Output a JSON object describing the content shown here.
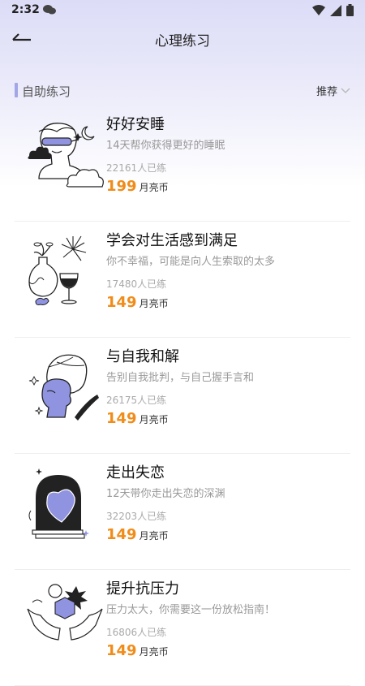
{
  "status": {
    "time": "2:32"
  },
  "header": {
    "title": "心理练习"
  },
  "section": {
    "title": "自助练习",
    "sort_label": "推荐"
  },
  "colors": {
    "accent": "#a3a6e6",
    "price": "#f08c1a",
    "illustration": "#8f93e0"
  },
  "items": [
    {
      "title": "好好安睡",
      "desc": "14天帮你获得更好的睡眠",
      "count": "22161人已练",
      "price": "199",
      "unit": "月亮币",
      "icon": "sleeping-statue-icon"
    },
    {
      "title": "学会对生活感到满足",
      "desc": "你不幸福，可能是向人生索取的太多",
      "count": "17480人已练",
      "price": "149",
      "unit": "月亮币",
      "icon": "vase-wine-icon"
    },
    {
      "title": "与自我和解",
      "desc": "告别自我批判，与自己握手言和",
      "count": "26175人已练",
      "price": "149",
      "unit": "月亮币",
      "icon": "two-faces-icon"
    },
    {
      "title": "走出失恋",
      "desc": "12天带你走出失恋的深渊",
      "count": "32203人已练",
      "price": "149",
      "unit": "月亮币",
      "icon": "heart-arch-icon"
    },
    {
      "title": "提升抗压力",
      "desc": "压力太大，你需要这一份放松指南！",
      "count": "16806人已练",
      "price": "149",
      "unit": "月亮币",
      "icon": "hands-hexagon-icon"
    }
  ]
}
